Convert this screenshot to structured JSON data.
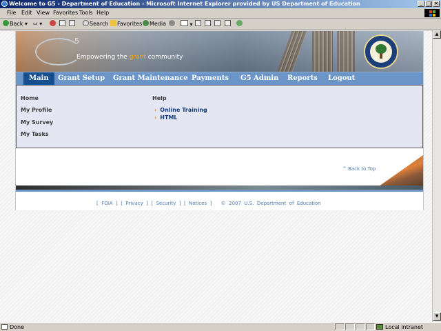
{
  "window": {
    "title": "Welcome to G5 - Department of Education - Microsoft Internet Explorer provided by US Department of Education"
  },
  "menu": [
    "File",
    "Edit",
    "View",
    "Favorites",
    "Tools",
    "Help"
  ],
  "toolbar": {
    "back": "Back",
    "search": "Search",
    "favorites": "Favorites",
    "media": "Media"
  },
  "banner": {
    "logo_number": "5",
    "tagline_before": "Empowering the ",
    "tagline_highlight": "grant",
    "tagline_after": " community"
  },
  "nav": [
    "Main",
    "Grant Setup",
    "Grant Maintenance",
    "Payments",
    "G5 Admin",
    "Reports",
    "Logout"
  ],
  "sidebar_links": [
    "Home",
    "My Profile",
    "My Survey",
    "My Tasks"
  ],
  "help": {
    "heading": "Help",
    "links": [
      "Online Training",
      "HTML"
    ]
  },
  "back_to_top": "^ Back to Top",
  "footer": {
    "links": [
      "FOIA",
      "Privacy",
      "Security",
      "Notices"
    ],
    "copyright": "©  2007  U.S.  Department  of  Education"
  },
  "statusbar": {
    "status": "Done",
    "zone": "Local intranet"
  },
  "colors": {
    "nav_bar": "#6a95c6",
    "nav_active": "#164f8e",
    "content_bg": "#e5e6f3",
    "link_accent": "#e08a12"
  }
}
